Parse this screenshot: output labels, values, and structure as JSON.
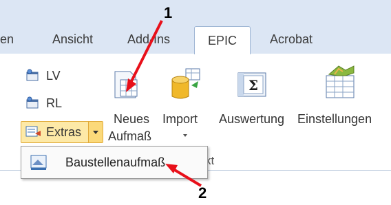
{
  "tabs": [
    "en",
    "Ansicht",
    "Add-Ins",
    "EPIC",
    "Acrobat"
  ],
  "active_tab": "EPIC",
  "small_buttons": {
    "lv": "LV",
    "rl": "RL",
    "extras": "Extras"
  },
  "large_buttons": {
    "neues_aufmass_line1": "Neues",
    "neues_aufmass_line2": "Aufmaß",
    "import": "Import",
    "auswertung": "Auswertung",
    "einstellungen": "Einstellungen"
  },
  "group_label_fragment": "kt",
  "dropdown": {
    "item": "Baustellenaufmaß"
  },
  "callouts": {
    "one": "1",
    "two": "2"
  },
  "colors": {
    "arrow": "#e8101a",
    "ribbon_bg": "#dce6f4",
    "highlight": "#fde9a7"
  }
}
